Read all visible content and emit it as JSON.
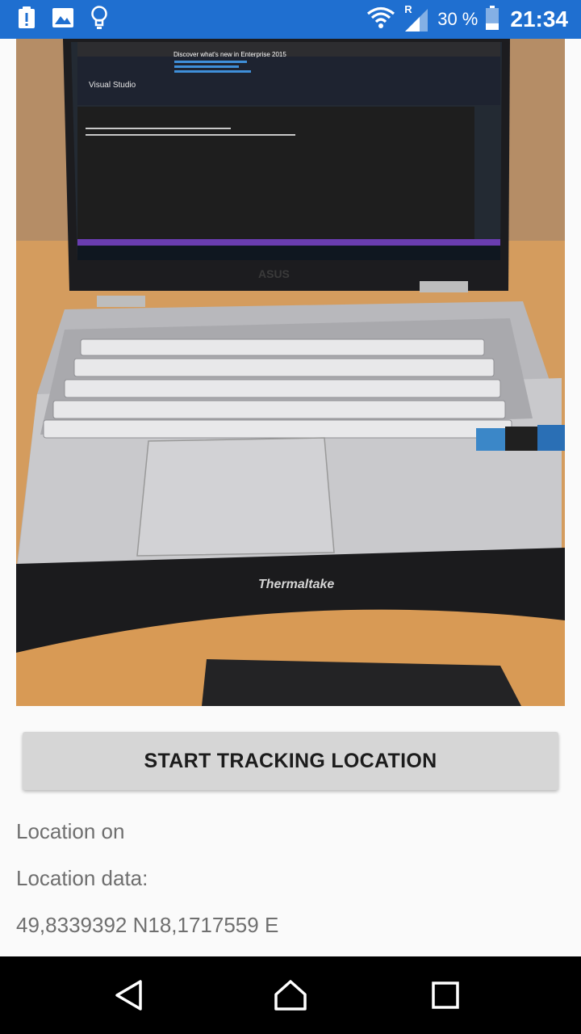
{
  "status_bar": {
    "left_icons": [
      "alert-icon",
      "image-icon",
      "lightbulb-icon"
    ],
    "network_label": "R",
    "battery_percent": "30 %",
    "battery_level": 0.3,
    "time": "21:34"
  },
  "photo": {
    "description_icon": "laptop-photo",
    "screen": {
      "app_title": "Visual Studio",
      "headline": "Discover what's new in Enterprise 2015",
      "brand_logo": "ASUS",
      "stand_brand": "Thermaltake"
    }
  },
  "main": {
    "track_button_label": "START TRACKING LOCATION",
    "location_status": "Location on",
    "location_data_label": "Location data:",
    "location_value": "49,8339392 N18,1717559 E"
  },
  "nav_bar": {
    "buttons": [
      "back-icon",
      "home-icon",
      "recents-icon"
    ]
  },
  "colors": {
    "status_bar": "#1f6fd0",
    "button_bg": "#d6d6d6",
    "text_secondary": "#6f6f6f"
  }
}
